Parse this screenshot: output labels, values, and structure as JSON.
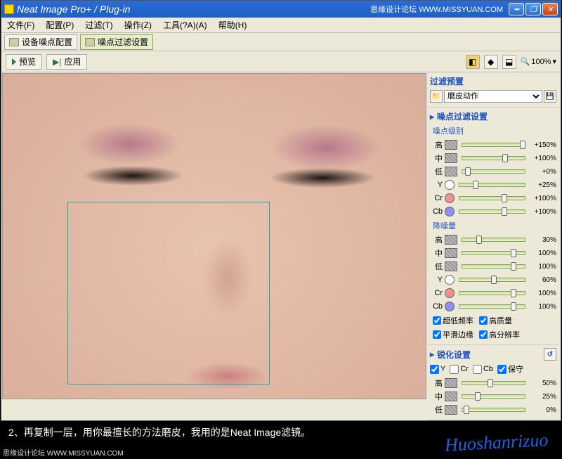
{
  "title": "Neat Image Pro+ / Plug-in",
  "watermark_top": "思缘设计论坛 WWW.MISSYUAN.COM",
  "menu": [
    "文件(F)",
    "配置(P)",
    "过滤(T)",
    "操作(Z)",
    "工具(?A)(A)",
    "帮助(H)"
  ],
  "tabs": [
    {
      "label": "设备噪点配置",
      "active": false
    },
    {
      "label": "噪点过滤设置",
      "active": true
    }
  ],
  "toolbar": {
    "preview": "预览",
    "apply": "应用",
    "zoom": "100%"
  },
  "side": {
    "filter_preset_title": "过滤预置",
    "preset_selected": "磨皮动作",
    "noise_filter_title": "噪点过滤设置",
    "noise_level_title": "噪点级别",
    "noise_level_rows": [
      {
        "lbl": "高",
        "val": "+150%",
        "pos": 92
      },
      {
        "lbl": "中",
        "val": "+100%",
        "pos": 64
      },
      {
        "lbl": "低",
        "val": "+0%",
        "pos": 4
      },
      {
        "lbl": "Y",
        "val": "+25%",
        "pos": 20,
        "c": "#fff"
      },
      {
        "lbl": "Cr",
        "val": "+100%",
        "pos": 64,
        "c": "#f09090"
      },
      {
        "lbl": "Cb",
        "val": "+100%",
        "pos": 64,
        "c": "#9090f0"
      }
    ],
    "noise_reduce_title": "降噪量",
    "noise_reduce_rows": [
      {
        "lbl": "高",
        "val": "30%",
        "pos": 22
      },
      {
        "lbl": "中",
        "val": "100%",
        "pos": 78
      },
      {
        "lbl": "低",
        "val": "100%",
        "pos": 78
      },
      {
        "lbl": "Y",
        "val": "60%",
        "pos": 48,
        "c": "#fff"
      },
      {
        "lbl": "Cr",
        "val": "100%",
        "pos": 78,
        "c": "#f09090"
      },
      {
        "lbl": "Cb",
        "val": "100%",
        "pos": 78,
        "c": "#9090f0"
      }
    ],
    "checks": [
      [
        "超低频率",
        "高质量"
      ],
      [
        "平滑边缘",
        "高分辨率"
      ]
    ],
    "sharpen_title": "锐化设置",
    "sharpen_channels": [
      "Y",
      "Cr",
      "Cb",
      "保守"
    ],
    "sharpen_rows": [
      {
        "lbl": "高",
        "val": "50%",
        "pos": 40
      },
      {
        "lbl": "中",
        "val": "25%",
        "pos": 20
      },
      {
        "lbl": "低",
        "val": "0%",
        "pos": 2
      }
    ]
  },
  "caption": "2、再复制一层，用你最擅长的方法磨皮，我用的是Neat Image滤镜。",
  "signature": "Huoshanrizuo",
  "footer_wm": "思缘设计论坛 WWW.MISSYUAN.COM"
}
